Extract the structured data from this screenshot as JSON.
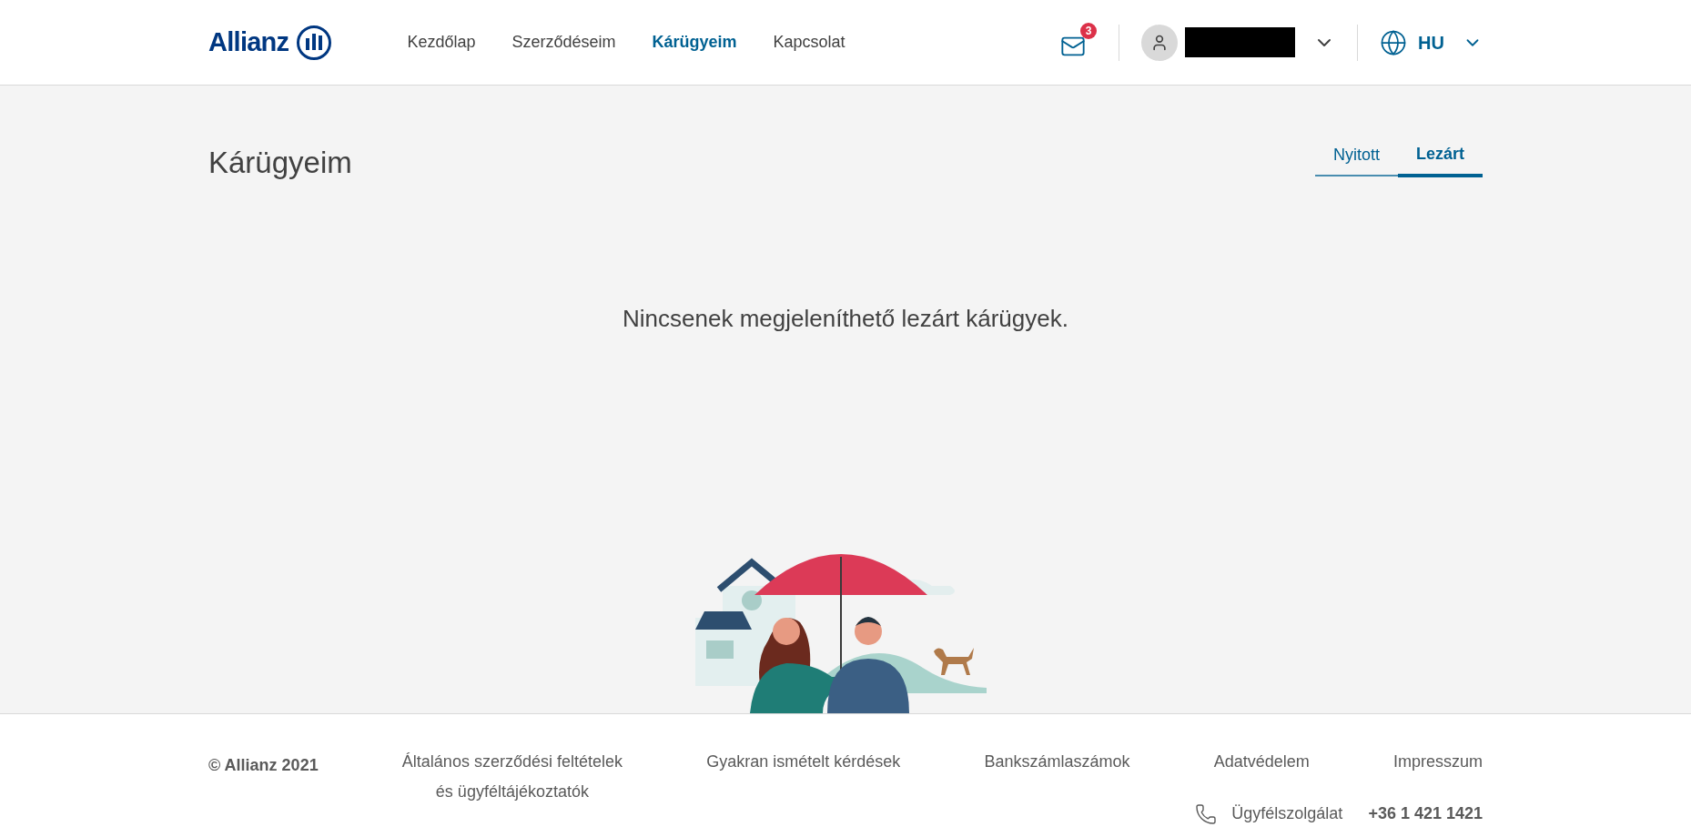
{
  "header": {
    "logo": "Allianz",
    "nav": [
      {
        "label": "Kezdőlap",
        "selected": false
      },
      {
        "label": "Szerződéseim",
        "selected": false
      },
      {
        "label": "Kárügyeim",
        "selected": true
      },
      {
        "label": "Kapcsolat",
        "selected": false
      }
    ],
    "mail_badge": "3",
    "language": "HU"
  },
  "page": {
    "title": "Kárügyeim",
    "tabs": [
      {
        "label": "Nyitott",
        "selected": false
      },
      {
        "label": "Lezárt",
        "selected": true
      }
    ],
    "empty_message": "Nincsenek megjeleníthető lezárt kárügyek."
  },
  "footer": {
    "copyright": "© Allianz 2021",
    "links": [
      {
        "lines": [
          "Általános szerződési feltételek",
          "és ügyféltájékoztatók"
        ]
      },
      {
        "lines": [
          "Gyakran ismételt kérdések"
        ]
      },
      {
        "lines": [
          "Bankszámlaszámok"
        ]
      },
      {
        "lines": [
          "Adatvédelem"
        ]
      },
      {
        "lines": [
          "Impresszum"
        ]
      }
    ],
    "support_label": "Ügyfélszolgálat",
    "support_phone": "+36 1 421 1421"
  }
}
